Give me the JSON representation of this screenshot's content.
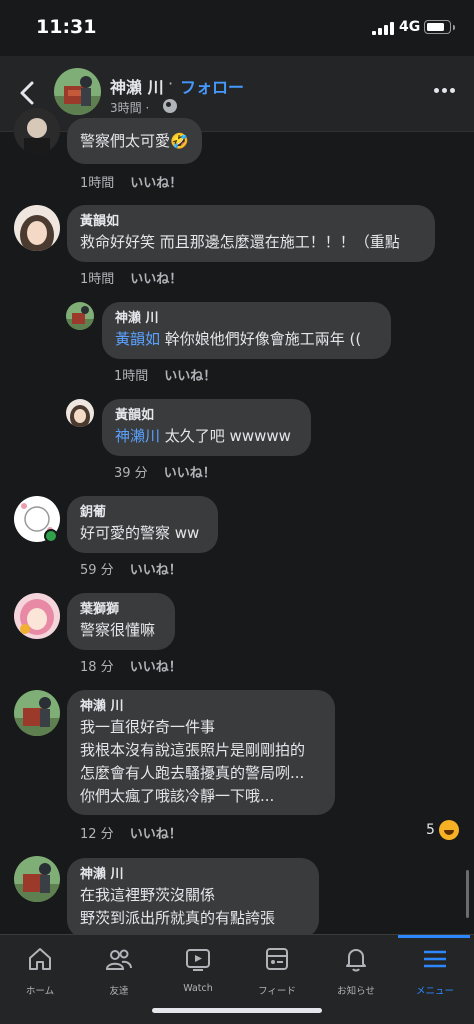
{
  "status_bar": {
    "time": "11:31",
    "network": "4G",
    "battery_level": 0.75
  },
  "header": {
    "author": "神瀨 川",
    "separator": "·",
    "follow": "フォロー",
    "post_time": "3時間 ·"
  },
  "comments": [
    {
      "text": "警察們太可愛🤣",
      "time": "1時間",
      "like": "いいね！"
    },
    {
      "name": "黃韻如",
      "text": "救命好好笑 而且那邊怎麼還在施工！！！（重點",
      "time": "1時間",
      "like": "いいね！"
    },
    {
      "name": "神瀨 川",
      "mention": "黃韻如",
      "text": " 幹你娘他們好像會施工兩年 ((",
      "time": "1時間",
      "like": "いいね！"
    },
    {
      "name": "黃韻如",
      "mention": "神瀨川",
      "text": " 太久了吧 wwwww",
      "time": "39 分",
      "like": "いいね！"
    },
    {
      "name": "鈅葡",
      "text": "好可愛的警察 ww",
      "time": "59 分",
      "like": "いいね！"
    },
    {
      "name": "葉獅獅",
      "text": "警察很懂嘛",
      "time": "18 分",
      "like": "いいね！"
    },
    {
      "name": "神瀨 川",
      "lines": [
        "我一直很好奇一件事",
        "我根本沒有說這張照片是剛剛拍的",
        "怎麼會有人跑去騷擾真的警局咧...",
        "你們太瘋了哦該冷靜一下哦..."
      ],
      "time": "12 分",
      "like": "いいね！",
      "reaction_count": "5"
    },
    {
      "name": "神瀨 川",
      "lines": [
        "在我這裡野茨沒關係",
        "野茨到派出所就真的有點誇張"
      ]
    }
  ],
  "tabs": [
    {
      "label": "ホーム",
      "icon": "home-icon"
    },
    {
      "label": "友達",
      "icon": "friends-icon"
    },
    {
      "label": "Watch",
      "icon": "watch-icon"
    },
    {
      "label": "フィード",
      "icon": "feed-icon"
    },
    {
      "label": "お知らせ",
      "icon": "bell-icon"
    },
    {
      "label": "メニュー",
      "icon": "menu-icon"
    }
  ],
  "colors": {
    "accent": "#2d88ff",
    "bubble": "#3a3b3c",
    "background": "#18191a"
  }
}
